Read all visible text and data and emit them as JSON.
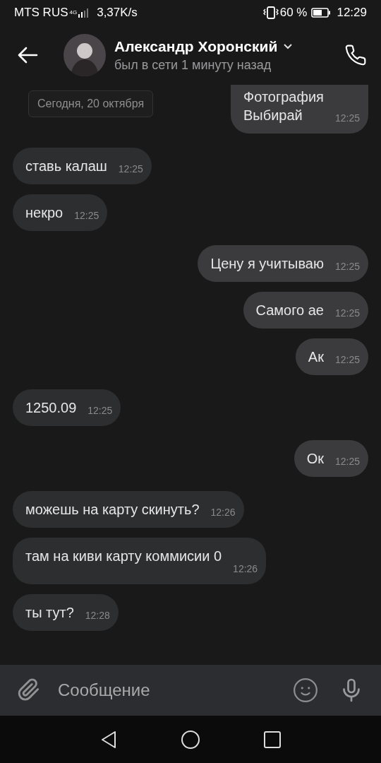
{
  "status_bar": {
    "carrier": "MTS RUS",
    "network": "4G",
    "speed": "3,37K/s",
    "battery": "60 %",
    "time": "12:29"
  },
  "header": {
    "name": "Александр Хоронский",
    "status": "был в сети 1 минуту назад"
  },
  "date_chip": "Сегодня, 20 октября",
  "messages": [
    {
      "kind": "out",
      "lines": [
        "Фотография",
        "Выбирай"
      ],
      "time": "12:25",
      "cut": true
    },
    {
      "kind": "in",
      "lines": [
        "ставь калаш"
      ],
      "time": "12:25"
    },
    {
      "kind": "in",
      "lines": [
        "некро"
      ],
      "time": "12:25"
    },
    {
      "kind": "out",
      "lines": [
        "Цену я учитываю"
      ],
      "time": "12:25"
    },
    {
      "kind": "out",
      "lines": [
        "Самого ае"
      ],
      "time": "12:25"
    },
    {
      "kind": "out",
      "lines": [
        "Ак"
      ],
      "time": "12:25"
    },
    {
      "kind": "in",
      "lines": [
        "1250.09"
      ],
      "time": "12:25"
    },
    {
      "kind": "out",
      "lines": [
        "Ок"
      ],
      "time": "12:25"
    },
    {
      "kind": "in",
      "lines": [
        "можешь на карту скинуть?"
      ],
      "time": "12:26"
    },
    {
      "kind": "in",
      "lines": [
        "там на киви карту коммисии 0"
      ],
      "time": "12:26",
      "time_below": true
    },
    {
      "kind": "in",
      "lines": [
        "ты тут?"
      ],
      "time": "12:28"
    }
  ],
  "composer": {
    "placeholder": "Сообщение"
  }
}
